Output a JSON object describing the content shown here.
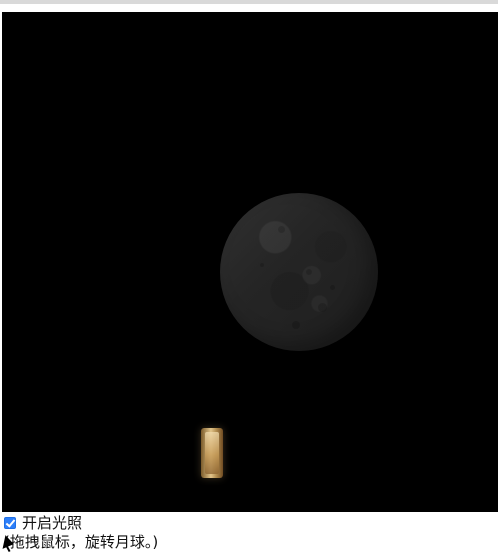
{
  "scene": {
    "moon_fill_color": "#2b2b2b",
    "panel_color": "#c8a36a",
    "background_color": "#000000"
  },
  "controls": {
    "lighting_label": "开启光照",
    "lighting_checked": true,
    "hint_text": "(拖拽鼠标，旋转月球。)"
  },
  "icons": {
    "checkbox": "checkbox-icon",
    "cursor": "mouse-cursor-icon",
    "moon": "moon-icon"
  }
}
